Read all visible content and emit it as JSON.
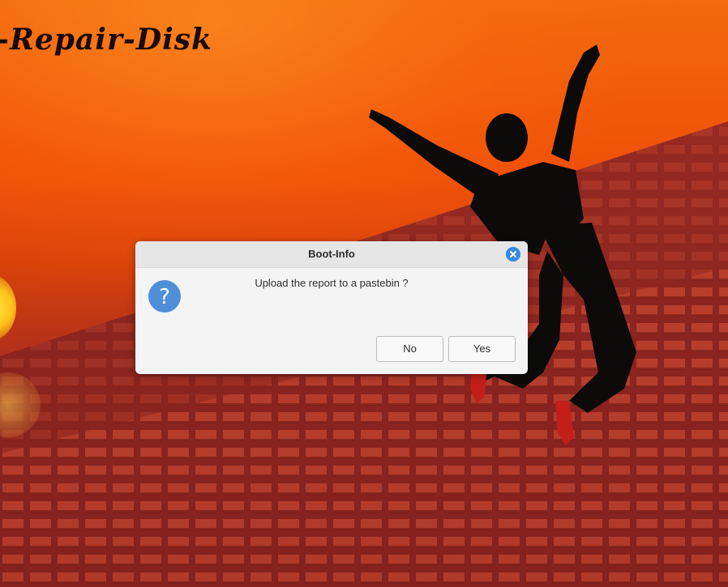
{
  "desktop": {
    "brand_text": "-Repair-Disk"
  },
  "dialog": {
    "title": "Boot-Info",
    "message": "Upload the report to a pastebin ?",
    "buttons": {
      "no_label": "No",
      "yes_label": "Yes"
    },
    "icons": {
      "close": "close-icon",
      "question": "question-icon"
    }
  },
  "colors": {
    "accent": "#3489e0",
    "question_icon": "#4f8fd8",
    "wallpaper_top": "#f26a0c",
    "wallpaper_bottom": "#8e2520"
  }
}
